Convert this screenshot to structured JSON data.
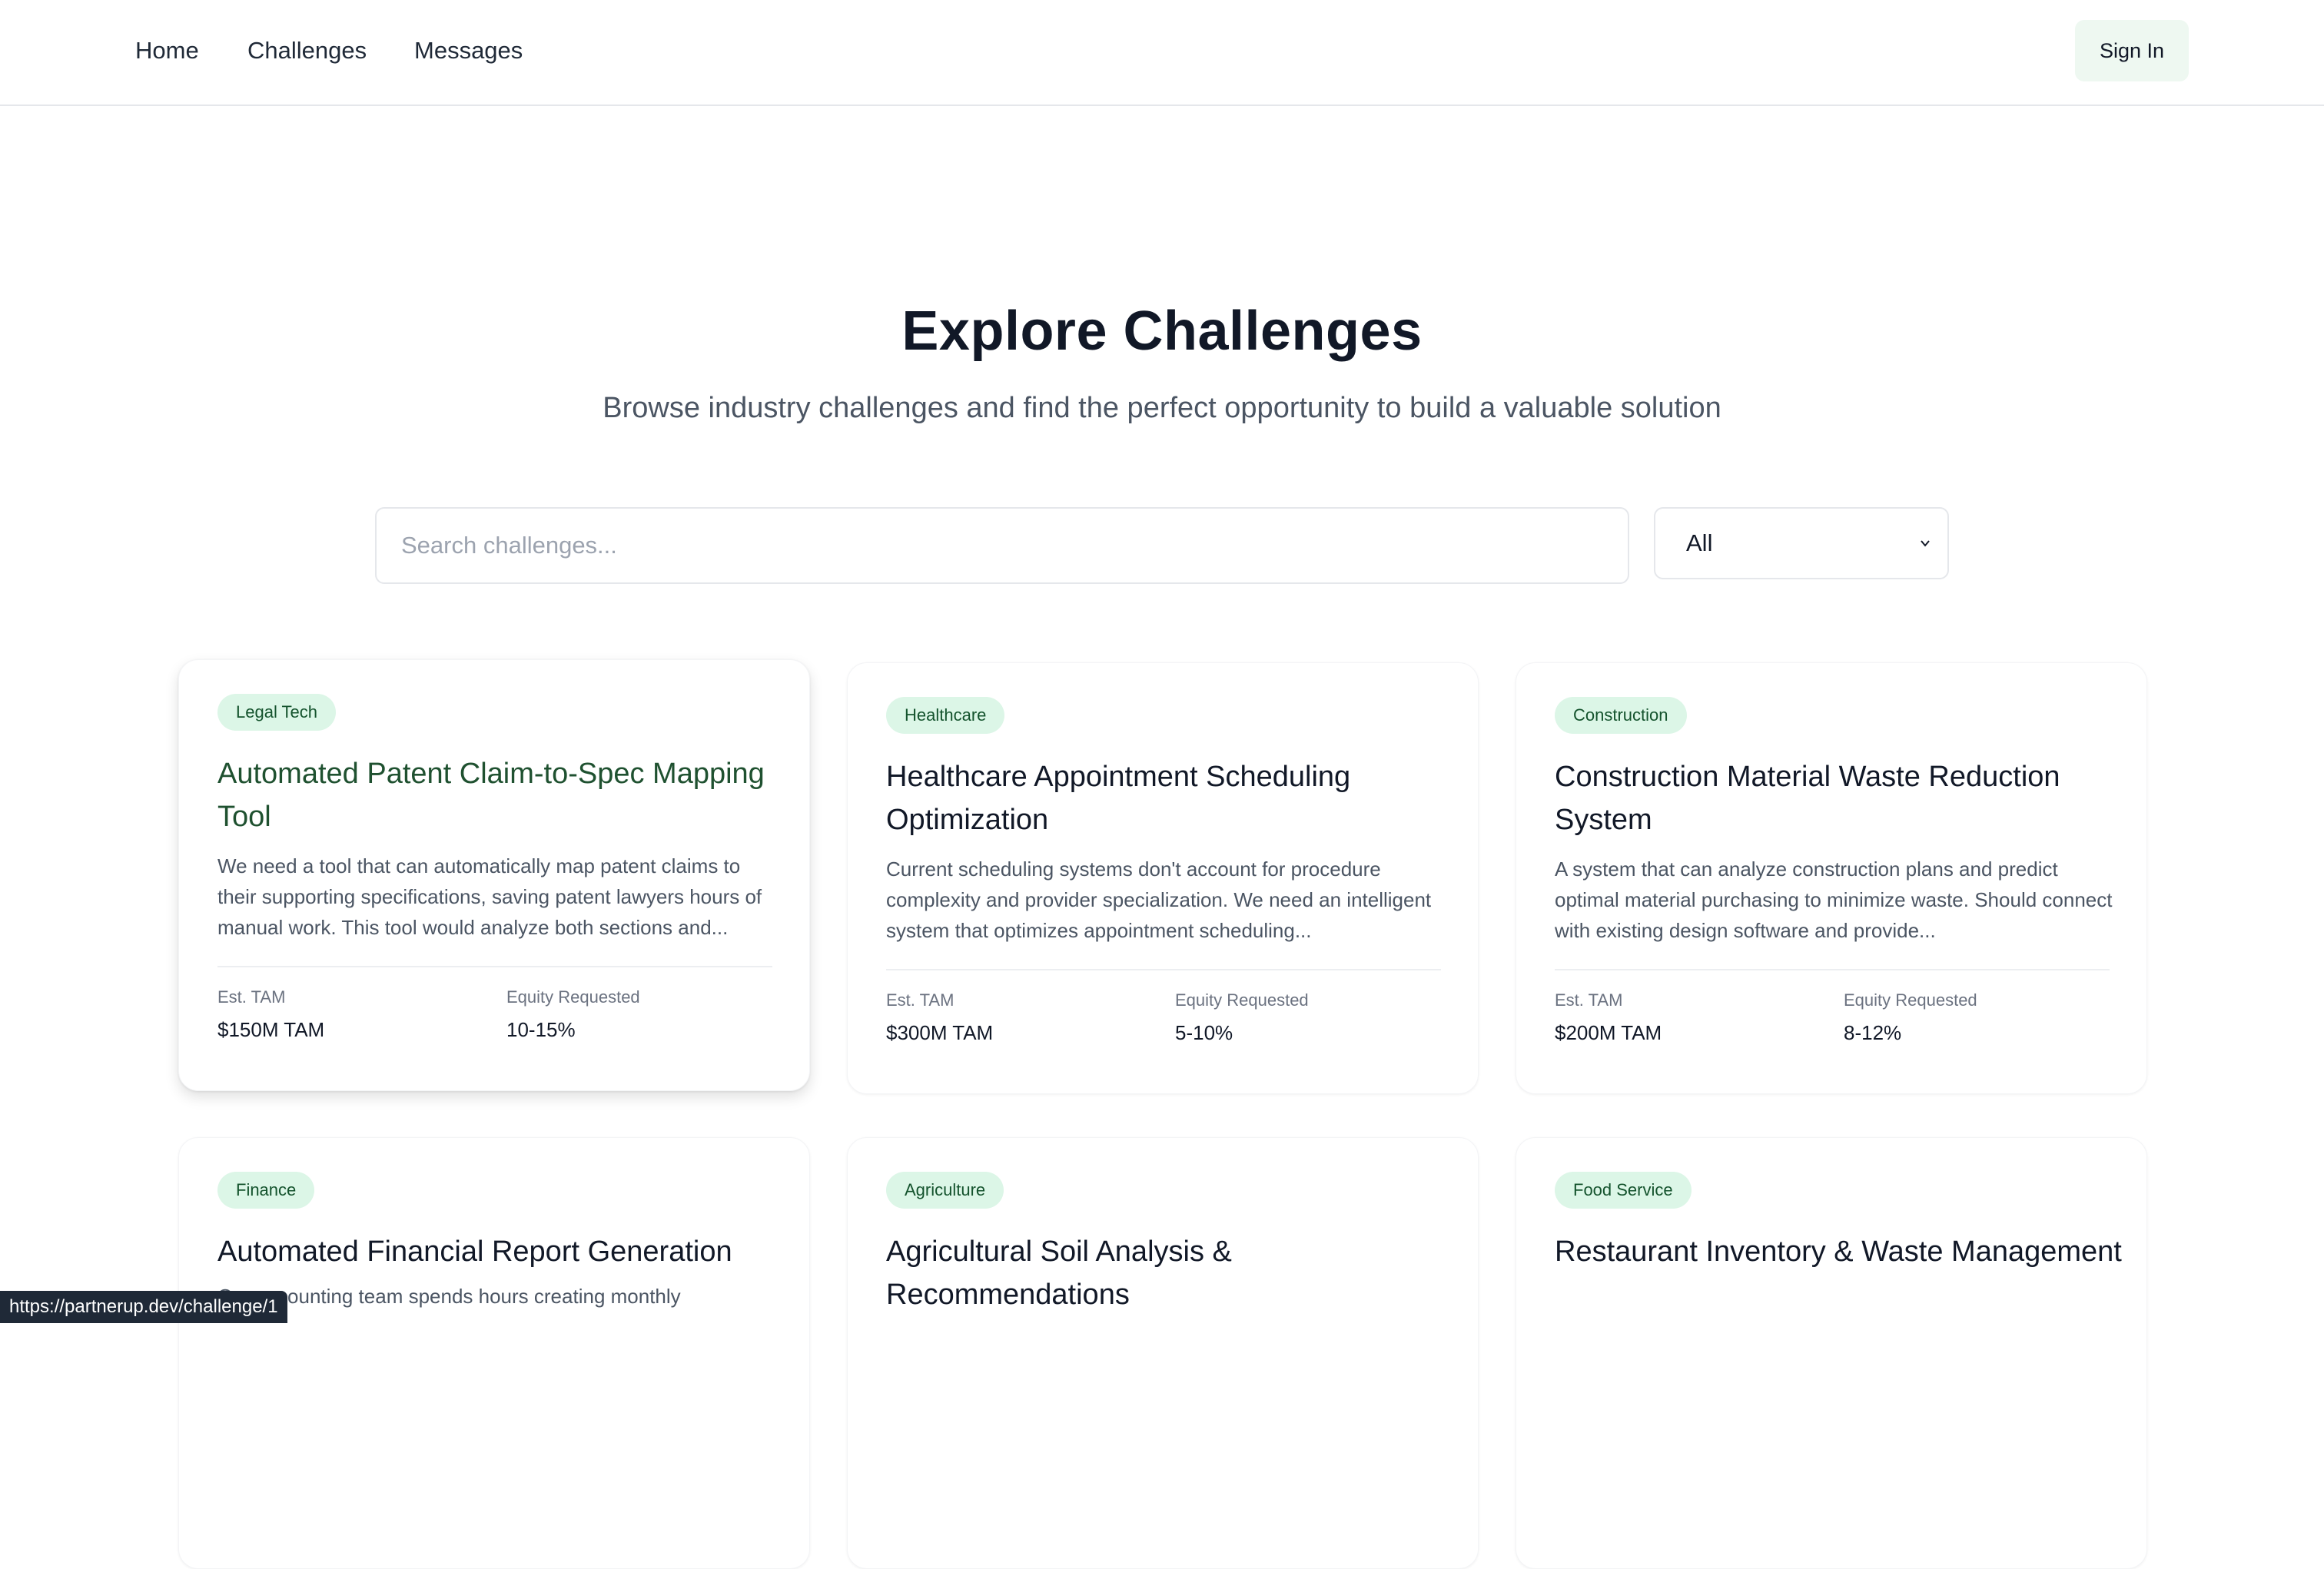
{
  "nav": {
    "links": [
      "Home",
      "Challenges",
      "Messages"
    ],
    "sign_in": "Sign In"
  },
  "hero": {
    "title": "Explore Challenges",
    "subtitle": "Browse industry challenges and find the perfect opportunity to build a valuable solution"
  },
  "search": {
    "placeholder": "Search challenges...",
    "value": ""
  },
  "filter": {
    "selected": "All"
  },
  "labels": {
    "tam": "Est. TAM",
    "equity": "Equity Requested"
  },
  "cards": [
    {
      "tag": "Legal Tech",
      "title": "Automated Patent Claim-to-Spec Mapping Tool",
      "description": "We need a tool that can automatically map patent claims to their supporting specifications, saving patent lawyers hours of manual work. This tool would analyze both sections and...",
      "tam": "$150M TAM",
      "equity": "10-15%"
    },
    {
      "tag": "Healthcare",
      "title": "Healthcare Appointment Scheduling Optimization",
      "description": "Current scheduling systems don't account for procedure complexity and provider specialization. We need an intelligent system that optimizes appointment scheduling...",
      "tam": "$300M TAM",
      "equity": "5-10%"
    },
    {
      "tag": "Construction",
      "title": "Construction Material Waste Reduction System",
      "description": "A system that can analyze construction plans and predict optimal material purchasing to minimize waste. Should connect with existing design software and provide...",
      "tam": "$200M TAM",
      "equity": "8-12%"
    },
    {
      "tag": "Finance",
      "title": "Automated Financial Report Generation",
      "description": "Our accounting team spends hours creating monthly"
    },
    {
      "tag": "Agriculture",
      "title": "Agricultural Soil Analysis & Recommendations",
      "description": ""
    },
    {
      "tag": "Food Service",
      "title": "Restaurant Inventory & Waste Management",
      "description": ""
    }
  ],
  "status_bar": {
    "url": "https://partnerup.dev/challenge/1"
  }
}
